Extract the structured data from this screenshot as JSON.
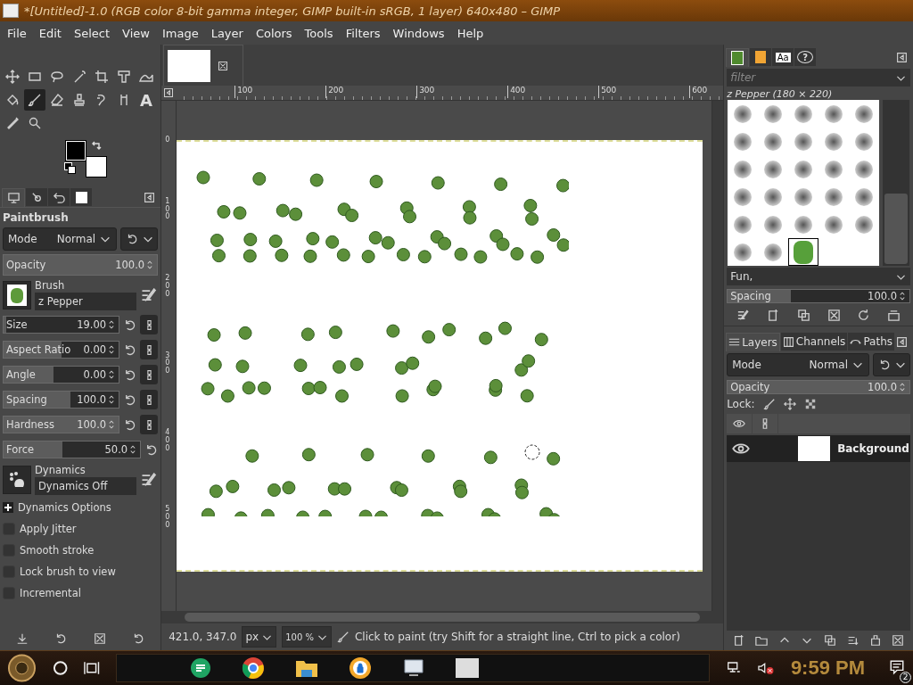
{
  "window": {
    "title": "*[Untitled]-1.0 (RGB color 8-bit gamma integer, GIMP built-in sRGB, 1 layer) 640x480 – GIMP"
  },
  "menu": [
    "File",
    "Edit",
    "Select",
    "View",
    "Image",
    "Layer",
    "Colors",
    "Tools",
    "Filters",
    "Windows",
    "Help"
  ],
  "toolbox": [
    {
      "selected": false
    },
    {
      "selected": false
    },
    {
      "selected": false
    },
    {
      "selected": false
    },
    {
      "selected": false
    },
    {
      "selected": false
    },
    {
      "selected": false
    },
    {
      "selected": false
    },
    {
      "selected": true
    },
    {
      "selected": false
    },
    {
      "selected": false
    },
    {
      "selected": false
    },
    {
      "selected": false
    },
    {
      "selected": false,
      "glyph": "A"
    },
    {
      "selected": false
    },
    {
      "selected": false
    }
  ],
  "left_dock_tabs": [
    {
      "selected": true
    },
    {
      "selected": false
    },
    {
      "selected": false
    },
    {
      "selected": false
    }
  ],
  "tool_options": {
    "title": "Paintbrush",
    "mode": {
      "label": "Mode",
      "value": "Normal"
    },
    "opacity": {
      "label": "Opacity",
      "value": "100.0",
      "level": 1
    },
    "brush": {
      "label": "Brush",
      "value": "z Pepper"
    },
    "sliders": [
      {
        "label": "Size",
        "value": "19.00",
        "level": 0.02,
        "link_button": true
      },
      {
        "label": "Aspect Ratio",
        "value": "0.00",
        "level": 0.5,
        "link_button": true
      },
      {
        "label": "Angle",
        "value": "0.00",
        "level": 0.43,
        "link_button": true
      },
      {
        "label": "Spacing",
        "value": "100.0",
        "level": 0.58,
        "link_button": true
      },
      {
        "label": "Hardness",
        "value": "100.0",
        "level": 1,
        "link_button": true
      },
      {
        "label": "Force",
        "value": "50.0",
        "level": 0.43,
        "link_button": false
      }
    ],
    "dynamics": {
      "label": "Dynamics",
      "value": "Dynamics Off"
    },
    "options": [
      {
        "kind": "expander",
        "label": "Dynamics Options",
        "expanded": false
      },
      {
        "kind": "checkbox",
        "label": "Apply Jitter",
        "checked": false
      },
      {
        "kind": "checkbox",
        "label": "Smooth stroke",
        "checked": false
      },
      {
        "kind": "checkbox",
        "label": "Lock brush to view",
        "checked": false
      },
      {
        "kind": "checkbox",
        "label": "Incremental",
        "checked": false
      }
    ]
  },
  "rulers": {
    "horizontal": [
      "100",
      "200",
      "300",
      "400",
      "500",
      "600"
    ],
    "vertical": [
      "0",
      "100",
      "200",
      "300",
      "400",
      "500"
    ]
  },
  "status_bar": {
    "pointer": "421.0, 347.0",
    "unit": "px",
    "zoom": "100 %",
    "message": "Click to paint (try Shift for a straight line, Ctrl to pick a color)"
  },
  "brushes_dock": {
    "tabs": [
      {
        "selected": true
      },
      {
        "selected": false
      },
      {
        "selected": false,
        "glyph": "Aa"
      },
      {
        "selected": false,
        "glyph": "?"
      }
    ],
    "filter_placeholder": "filter",
    "current": "z Pepper (180 × 220)",
    "brushes": [
      {
        "selected": false
      },
      {
        "selected": false
      },
      {
        "selected": false
      },
      {
        "selected": false
      },
      {
        "selected": false
      },
      {
        "selected": false
      },
      {
        "selected": false
      },
      {
        "selected": false
      },
      {
        "selected": false
      },
      {
        "selected": false
      },
      {
        "selected": false
      },
      {
        "selected": false
      },
      {
        "selected": false
      },
      {
        "selected": false
      },
      {
        "selected": false
      },
      {
        "selected": false
      },
      {
        "selected": false
      },
      {
        "selected": false
      },
      {
        "selected": false
      },
      {
        "selected": false
      },
      {
        "selected": false
      },
      {
        "selected": false
      },
      {
        "selected": false
      },
      {
        "selected": false
      },
      {
        "selected": false
      },
      {
        "selected": false
      },
      {
        "selected": false
      },
      {
        "selected": true
      }
    ],
    "tag": "Fun,",
    "spacing": {
      "label": "Spacing",
      "value": "100.0",
      "level": 0.35
    }
  },
  "layers_dock": {
    "tabs": [
      {
        "label": "Layers",
        "selected": true
      },
      {
        "label": "Channels",
        "selected": false
      },
      {
        "label": "Paths",
        "selected": false
      }
    ],
    "mode": {
      "label": "Mode",
      "value": "Normal"
    },
    "opacity": {
      "label": "Opacity",
      "value": "100.0",
      "level": 1
    },
    "lock_label": "Lock:",
    "layers": [
      {
        "name": "Background",
        "visible": true,
        "selected": true
      }
    ]
  },
  "taskbar": {
    "time": "9:59 PM",
    "notifications": "2",
    "muted": true
  }
}
